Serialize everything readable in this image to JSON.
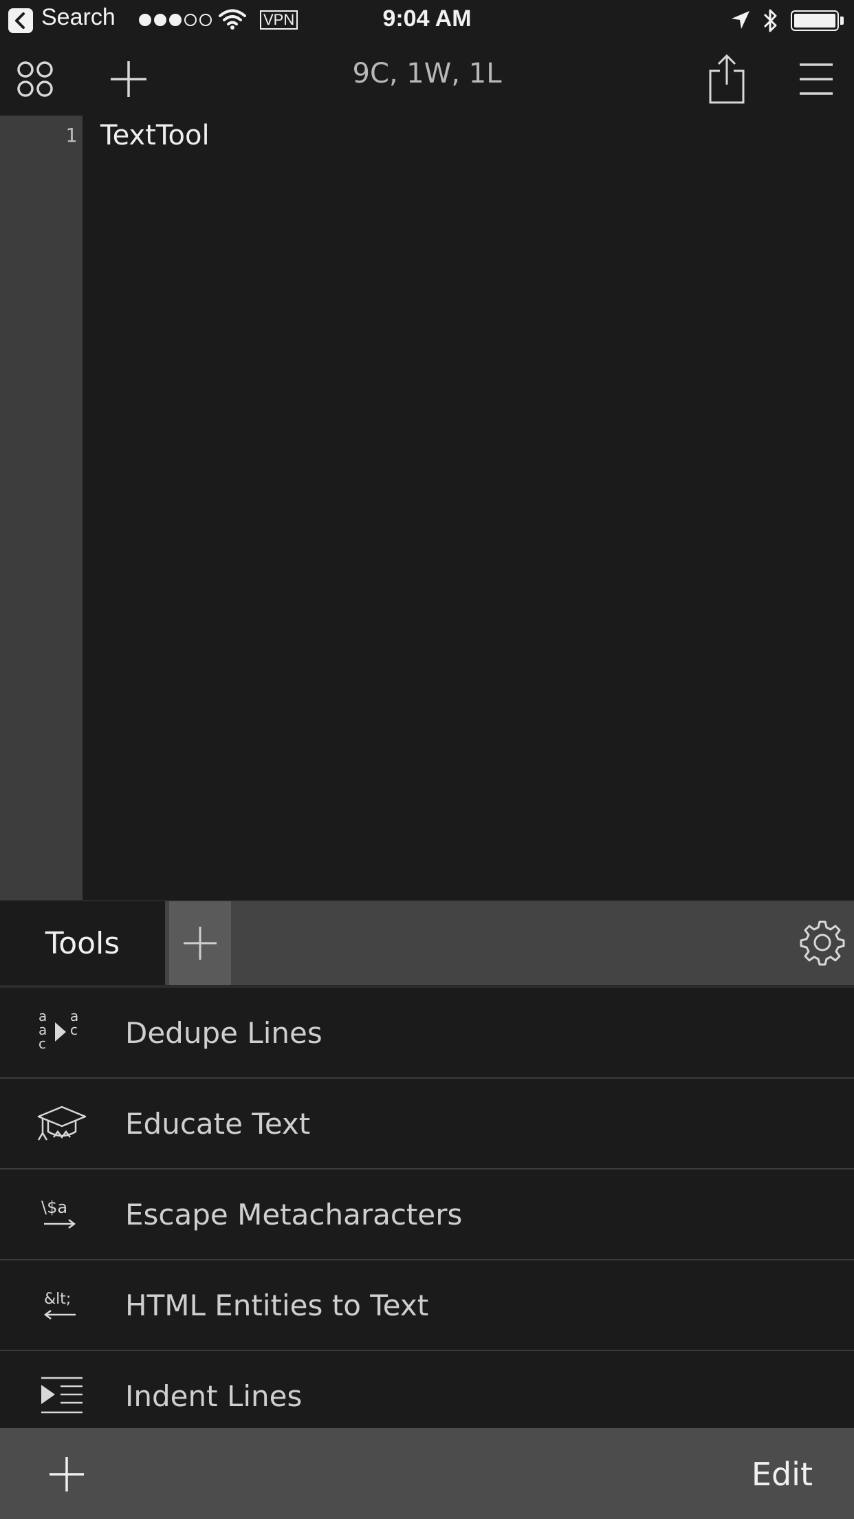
{
  "status_bar": {
    "back_label": "Search",
    "time": "9:04 AM",
    "vpn_label": "VPN",
    "signal_bars_filled": 3,
    "signal_bars_total": 5
  },
  "toolbar": {
    "title": "9C, 1W, 1L",
    "icons": [
      "grid-icon",
      "plus-icon",
      "share-icon",
      "menu-icon"
    ]
  },
  "editor": {
    "lines": [
      {
        "number": "1",
        "text": "TextTool"
      }
    ]
  },
  "tabs": {
    "active_label": "Tools"
  },
  "tools": [
    {
      "label": "Dedupe Lines",
      "icon": "dedupe-icon"
    },
    {
      "label": "Educate Text",
      "icon": "graduation-cap-icon"
    },
    {
      "label": "Escape Metacharacters",
      "icon": "escape-icon"
    },
    {
      "label": "HTML Entities to Text",
      "icon": "html-entities-icon"
    },
    {
      "label": "Indent Lines",
      "icon": "indent-icon"
    }
  ],
  "bottom_bar": {
    "edit_label": "Edit"
  },
  "colors": {
    "background": "#1b1b1c",
    "gutter": "#3d3d3e",
    "tab_bar": "#444445",
    "bottom_bar": "#4c4c4d",
    "text": "#cfcfcf"
  }
}
